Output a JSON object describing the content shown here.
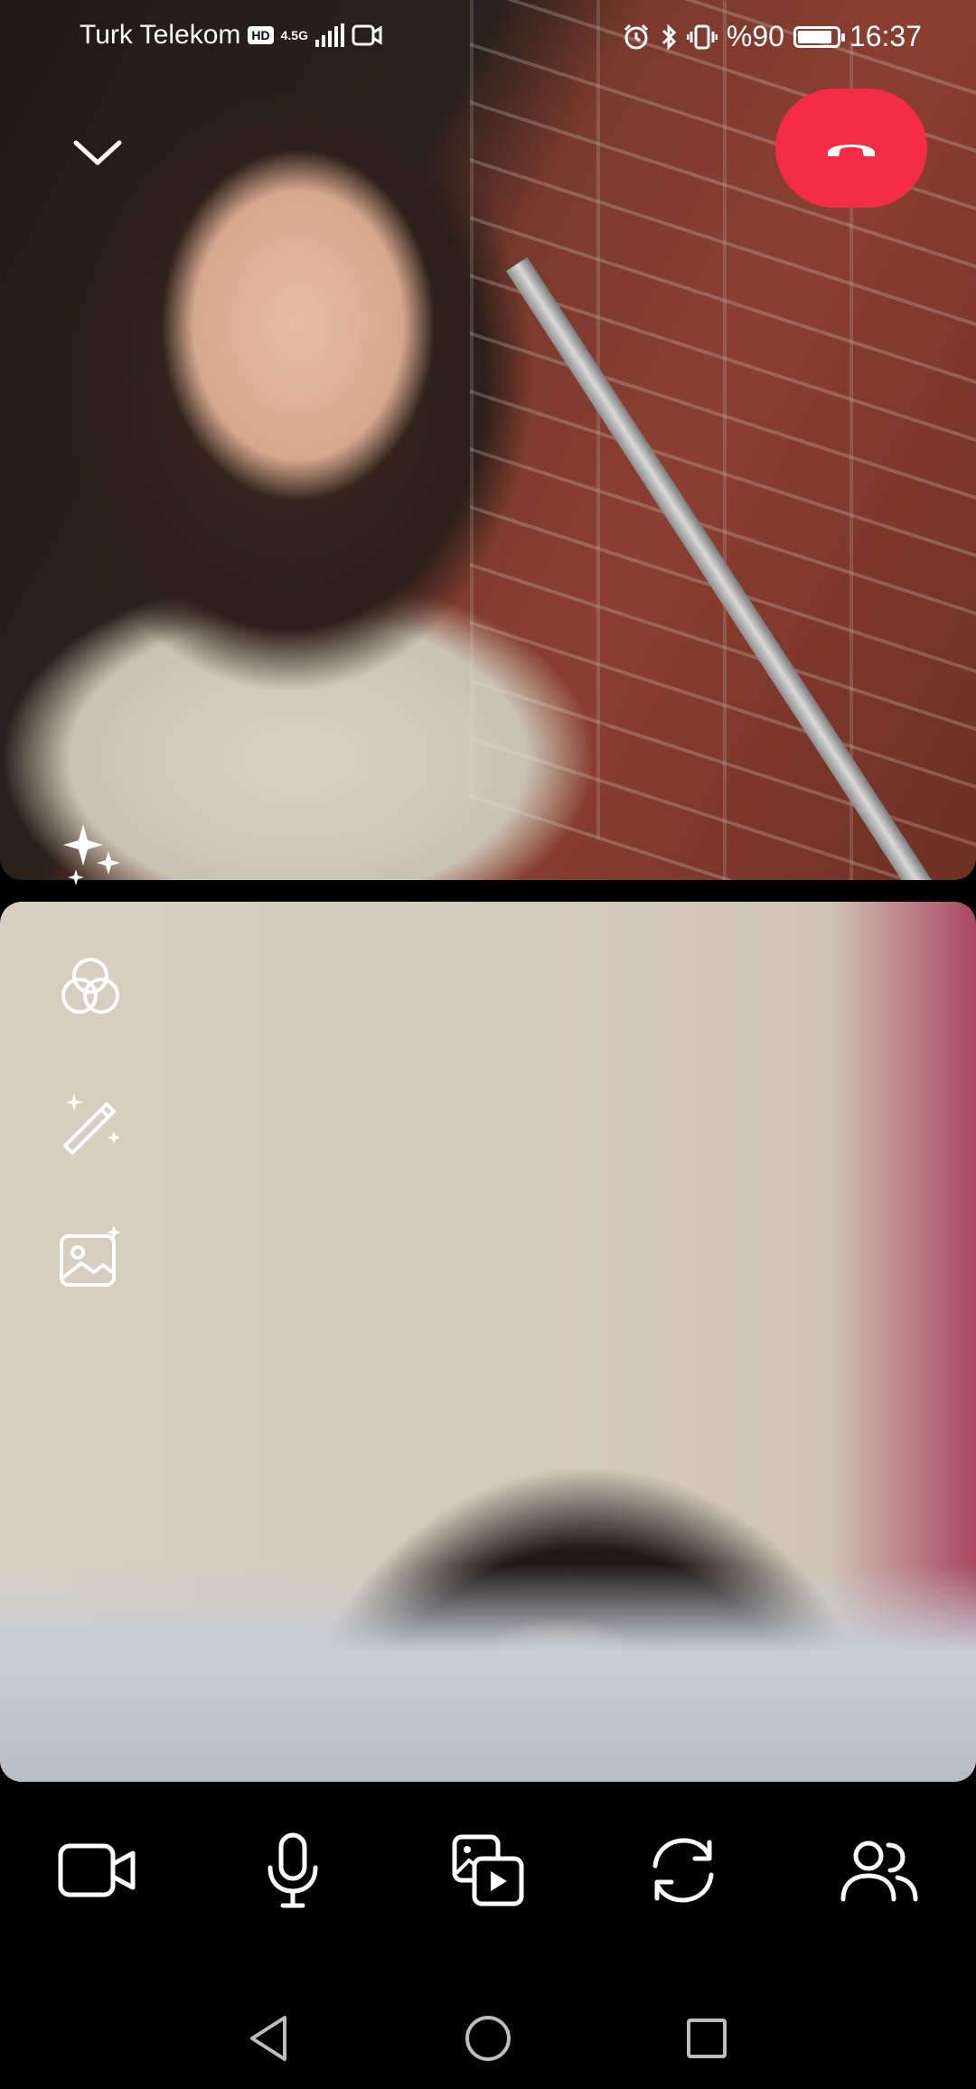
{
  "status_bar": {
    "carrier": "Turk Telekom",
    "hd_badge": "HD",
    "network_type": "4.5G",
    "battery_percent_text": "%90",
    "battery_level": 0.9,
    "time": "16:37"
  },
  "call": {
    "end_call_color": "#f42d46"
  },
  "icons": {
    "collapse": "chevron-down-icon",
    "end_call": "hang-up-icon",
    "effects": "sparkles-icon",
    "filters": "overlapping-circles-icon",
    "beauty": "magic-wand-icon",
    "background": "image-sparkle-icon",
    "camera": "video-camera-icon",
    "mic": "microphone-icon",
    "share": "media-share-icon",
    "switch_camera": "rotate-camera-icon",
    "participants": "people-icon",
    "nav_back": "triangle-back-icon",
    "nav_home": "circle-home-icon",
    "nav_recents": "square-recents-icon"
  }
}
